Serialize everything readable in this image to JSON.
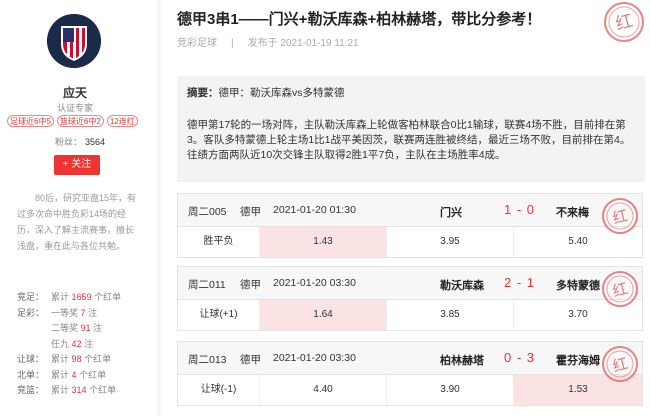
{
  "profile": {
    "name": "应天",
    "role": "认证专家",
    "badges": [
      "足球近6中5",
      "篮球近6中2",
      "12连红"
    ],
    "fans_label": "粉丝：",
    "fans_count": "3564",
    "follow_label": "+ 关注",
    "bio": "80后，研究亚盘15年，有过多次命中胜负彩14场的经历，深入了解主流赛事，擅长浅盘，重在此与各位共勉。",
    "stats": [
      {
        "key": "竞足：",
        "pre": "累计",
        "num": "1659",
        "post": "个红单"
      },
      {
        "key": "足彩：",
        "pre": "一等奖",
        "num": "7",
        "post": "注"
      },
      {
        "key": "",
        "pre": "二等奖",
        "num": "91",
        "post": "注"
      },
      {
        "key": "",
        "pre": "任九",
        "num": "42",
        "post": "注"
      },
      {
        "key": "让球：",
        "pre": "累计",
        "num": "98",
        "post": "个红单"
      },
      {
        "key": "北单：",
        "pre": "累计",
        "num": "4",
        "post": "个红单"
      },
      {
        "key": "竞篮：",
        "pre": "累计",
        "num": "314",
        "post": "个红单"
      }
    ]
  },
  "article": {
    "title": "德甲3串1——门兴+勒沃库森+柏林赫塔，带比分参考！",
    "category": "竞彩足球",
    "sep": "|",
    "published": "发布于 2021-01-19 11:21",
    "stamp_text": "红",
    "summary_label": "摘要：",
    "summary_text": "德甲：勒沃库森vs多特蒙德",
    "body": "德甲第17轮的一场对阵，主队勒沃库森上轮做客柏林联合0比1输球，联赛4场不胜，目前排在第3。客队多特蒙德上轮主场1比1战平美因茨，联赛两连胜被终结，最近三场不败，目前排在第4。往绩方面两队近10次交锋主队取得2胜1平7负，主队在主场胜率4成。"
  },
  "matches": [
    {
      "no": "周二005",
      "league": "德甲",
      "time": "2021-01-20 01:30",
      "home": "门兴",
      "score": "1 - 0",
      "away": "不来梅",
      "bet": "胜平负",
      "odds": [
        "1.43",
        "3.95",
        "5.40"
      ],
      "pick": 0
    },
    {
      "no": "周二011",
      "league": "德甲",
      "time": "2021-01-20 03:30",
      "home": "勒沃库森",
      "score": "2 - 1",
      "away": "多特蒙德",
      "bet": "让球(+1)",
      "odds": [
        "1.64",
        "3.85",
        "3.70"
      ],
      "pick": 0
    },
    {
      "no": "周二013",
      "league": "德甲",
      "time": "2021-01-20 03:30",
      "home": "柏林赫塔",
      "score": "0 - 3",
      "away": "霍芬海姆",
      "bet": "让球(-1)",
      "odds": [
        "4.40",
        "3.90",
        "1.53"
      ],
      "pick": 2
    }
  ],
  "colors": {
    "accent": "#e33333",
    "highlight": "#fbe3e3",
    "stamp": "#e46464"
  }
}
